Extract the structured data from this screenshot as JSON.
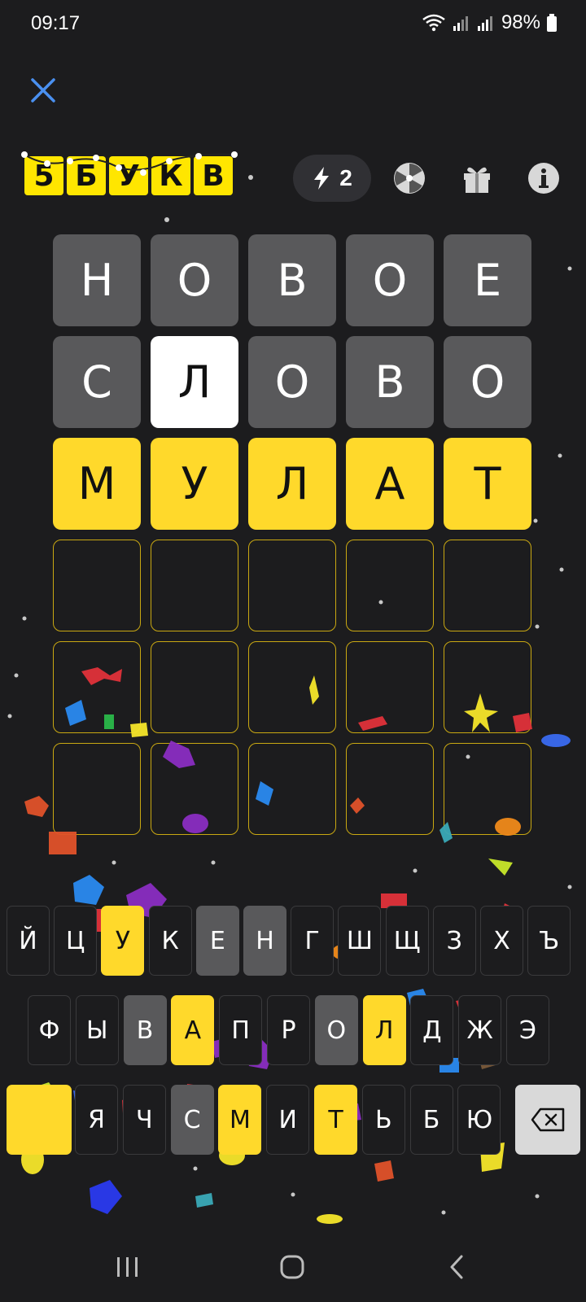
{
  "status": {
    "time": "09:17",
    "battery": "98%"
  },
  "logo": {
    "letters": [
      "5",
      "Б",
      "У",
      "К",
      "В"
    ]
  },
  "toolbar": {
    "hint_count": "2"
  },
  "board": {
    "rows": [
      [
        {
          "l": "Н",
          "s": "gray"
        },
        {
          "l": "О",
          "s": "gray"
        },
        {
          "l": "В",
          "s": "gray"
        },
        {
          "l": "О",
          "s": "gray"
        },
        {
          "l": "Е",
          "s": "gray"
        }
      ],
      [
        {
          "l": "С",
          "s": "gray"
        },
        {
          "l": "Л",
          "s": "white"
        },
        {
          "l": "О",
          "s": "gray"
        },
        {
          "l": "В",
          "s": "gray"
        },
        {
          "l": "О",
          "s": "gray"
        }
      ],
      [
        {
          "l": "М",
          "s": "yellow"
        },
        {
          "l": "У",
          "s": "yellow"
        },
        {
          "l": "Л",
          "s": "yellow"
        },
        {
          "l": "А",
          "s": "yellow"
        },
        {
          "l": "Т",
          "s": "yellow"
        }
      ],
      [
        {
          "l": "",
          "s": "empty"
        },
        {
          "l": "",
          "s": "empty"
        },
        {
          "l": "",
          "s": "empty"
        },
        {
          "l": "",
          "s": "empty"
        },
        {
          "l": "",
          "s": "empty"
        }
      ],
      [
        {
          "l": "",
          "s": "empty"
        },
        {
          "l": "",
          "s": "empty"
        },
        {
          "l": "",
          "s": "empty"
        },
        {
          "l": "",
          "s": "empty"
        },
        {
          "l": "",
          "s": "empty"
        }
      ],
      [
        {
          "l": "",
          "s": "empty"
        },
        {
          "l": "",
          "s": "empty"
        },
        {
          "l": "",
          "s": "empty"
        },
        {
          "l": "",
          "s": "empty"
        },
        {
          "l": "",
          "s": "empty"
        }
      ]
    ]
  },
  "keyboard": {
    "rows": [
      [
        {
          "k": "Й",
          "s": "none"
        },
        {
          "k": "Ц",
          "s": "none"
        },
        {
          "k": "У",
          "s": "yellow"
        },
        {
          "k": "К",
          "s": "none"
        },
        {
          "k": "Е",
          "s": "gray"
        },
        {
          "k": "Н",
          "s": "gray"
        },
        {
          "k": "Г",
          "s": "none"
        },
        {
          "k": "Ш",
          "s": "none"
        },
        {
          "k": "Щ",
          "s": "none"
        },
        {
          "k": "З",
          "s": "none"
        },
        {
          "k": "Х",
          "s": "none"
        },
        {
          "k": "Ъ",
          "s": "none"
        }
      ],
      [
        {
          "k": "Ф",
          "s": "none"
        },
        {
          "k": "Ы",
          "s": "none"
        },
        {
          "k": "В",
          "s": "gray"
        },
        {
          "k": "А",
          "s": "yellow"
        },
        {
          "k": "П",
          "s": "none"
        },
        {
          "k": "Р",
          "s": "none"
        },
        {
          "k": "О",
          "s": "gray"
        },
        {
          "k": "Л",
          "s": "yellow"
        },
        {
          "k": "Д",
          "s": "none"
        },
        {
          "k": "Ж",
          "s": "none"
        },
        {
          "k": "Э",
          "s": "none"
        }
      ],
      [
        {
          "k": "Я",
          "s": "none"
        },
        {
          "k": "Ч",
          "s": "none"
        },
        {
          "k": "С",
          "s": "gray"
        },
        {
          "k": "М",
          "s": "yellow"
        },
        {
          "k": "И",
          "s": "none"
        },
        {
          "k": "Т",
          "s": "yellow"
        },
        {
          "k": "Ь",
          "s": "none"
        },
        {
          "k": "Б",
          "s": "none"
        },
        {
          "k": "Ю",
          "s": "none"
        }
      ]
    ],
    "backspace_icon": "backspace-icon"
  },
  "colors": {
    "background": "#1c1c1e",
    "gray": "#59595b",
    "yellow": "#ffd92b",
    "empty_border": "#c9a812"
  }
}
